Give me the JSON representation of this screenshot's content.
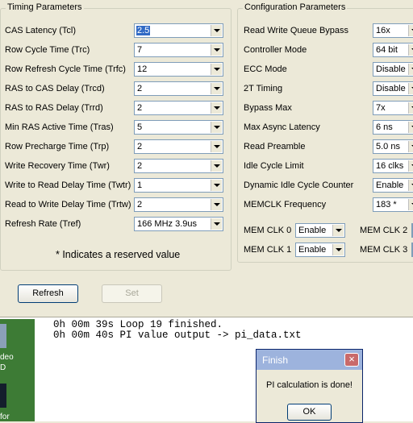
{
  "timing": {
    "title": "Timing Parameters",
    "rows": [
      {
        "label": "CAS Latency (Tcl)",
        "value": "2.5",
        "selected": true
      },
      {
        "label": "Row Cycle Time (Trc)",
        "value": "7"
      },
      {
        "label": "Row Refresh Cycle Time (Trfc)",
        "value": "12"
      },
      {
        "label": "RAS to CAS Delay (Trcd)",
        "value": "2"
      },
      {
        "label": "RAS to RAS Delay (Trrd)",
        "value": "2"
      },
      {
        "label": "Min RAS Active Time (Tras)",
        "value": "5"
      },
      {
        "label": "Row Precharge Time (Trp)",
        "value": "2"
      },
      {
        "label": "Write Recovery Time (Twr)",
        "value": "2"
      },
      {
        "label": "Write to Read Delay Time (Twtr)",
        "value": "1"
      },
      {
        "label": "Read to Write Delay Time (Trtw)",
        "value": "2"
      },
      {
        "label": "Refresh Rate (Tref)",
        "value": "166 MHz 3.9us"
      }
    ],
    "note": "* Indicates a reserved value"
  },
  "config": {
    "title": "Configuration Parameters",
    "rows": [
      {
        "label": "Read Write Queue Bypass",
        "value": "16x"
      },
      {
        "label": "Controller Mode",
        "value": "64 bit"
      },
      {
        "label": "ECC Mode",
        "value": "Disable"
      },
      {
        "label": "2T Timing",
        "value": "Disable"
      },
      {
        "label": "Bypass Max",
        "value": "7x"
      },
      {
        "label": "Max Async Latency",
        "value": "6 ns"
      },
      {
        "label": "Read Preamble",
        "value": "5.0 ns"
      },
      {
        "label": "Idle Cycle Limit",
        "value": "16 clks"
      },
      {
        "label": "Dynamic Idle Cycle Counter",
        "value": "Enable"
      },
      {
        "label": "MEMCLK Frequency",
        "value": "183 *"
      }
    ],
    "memclk": [
      {
        "label": "MEM CLK 0",
        "value": "Enable"
      },
      {
        "label": "MEM CLK 1",
        "value": "Enable"
      },
      {
        "label": "MEM CLK 2",
        "value": ""
      },
      {
        "label": "MEM CLK 3",
        "value": ""
      }
    ]
  },
  "buttons": {
    "refresh": "Refresh",
    "set": "Set"
  },
  "console": {
    "lines": [
      "0h 00m 39s Loop 19 finished.",
      "0h 00m 40s PI value output -> pi_data.txt"
    ]
  },
  "desktop": {
    "texts": [
      "deo",
      "D",
      "for"
    ]
  },
  "dialog": {
    "title": "Finish",
    "message": "PI calculation is done!",
    "ok": "OK",
    "close": "×"
  }
}
